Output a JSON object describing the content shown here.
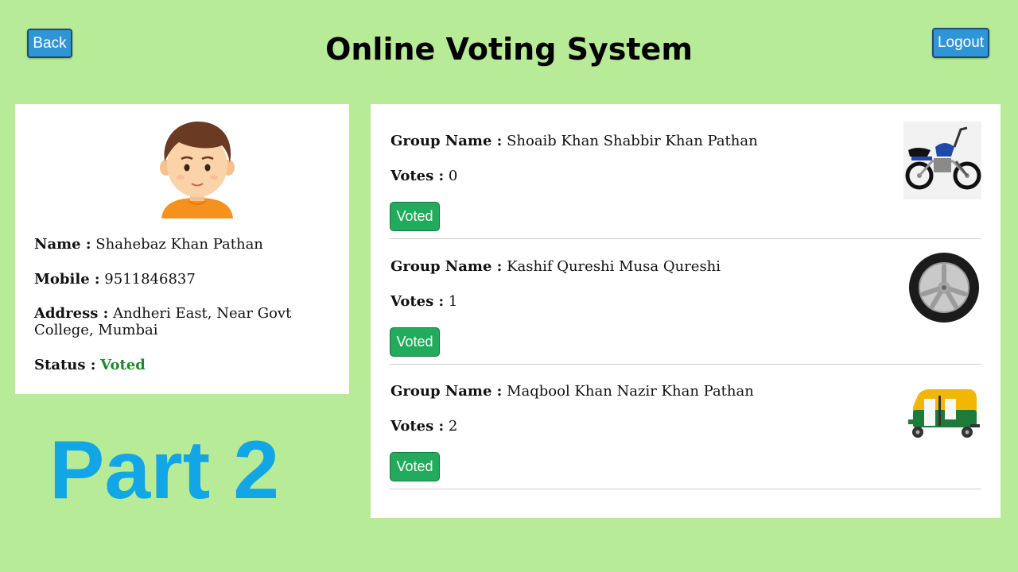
{
  "header": {
    "back_label": "Back",
    "title": "Online Voting System",
    "logout_label": "Logout"
  },
  "voter": {
    "avatar_icon": "user-avatar-icon",
    "name_label": "Name :",
    "name": "Shahebaz Khan Pathan",
    "mobile_label": "Mobile :",
    "mobile": "9511846837",
    "address_label": "Address :",
    "address": "Andheri East, Near Govt College, Mumbai",
    "status_label": "Status :",
    "status": "Voted",
    "status_color": "#1e8a2f"
  },
  "overlay_text": "Part 2",
  "groups": [
    {
      "name_label": "Group Name :",
      "name": "Shoaib Khan Shabbir Khan Pathan",
      "votes_label": "Votes :",
      "votes": "0",
      "button_label": "Voted",
      "symbol": "motorcycle-icon"
    },
    {
      "name_label": "Group Name :",
      "name": "Kashif Qureshi Musa Qureshi",
      "votes_label": "Votes :",
      "votes": "1",
      "button_label": "Voted",
      "symbol": "tyre-icon"
    },
    {
      "name_label": "Group Name :",
      "name": "Maqbool Khan Nazir Khan Pathan",
      "votes_label": "Votes :",
      "votes": "2",
      "button_label": "Voted",
      "symbol": "auto-rickshaw-icon"
    }
  ],
  "colors": {
    "background": "#b8eb97",
    "button_blue": "#2e95d6",
    "button_green": "#22ab5c",
    "part_text": "#12a6e6"
  }
}
